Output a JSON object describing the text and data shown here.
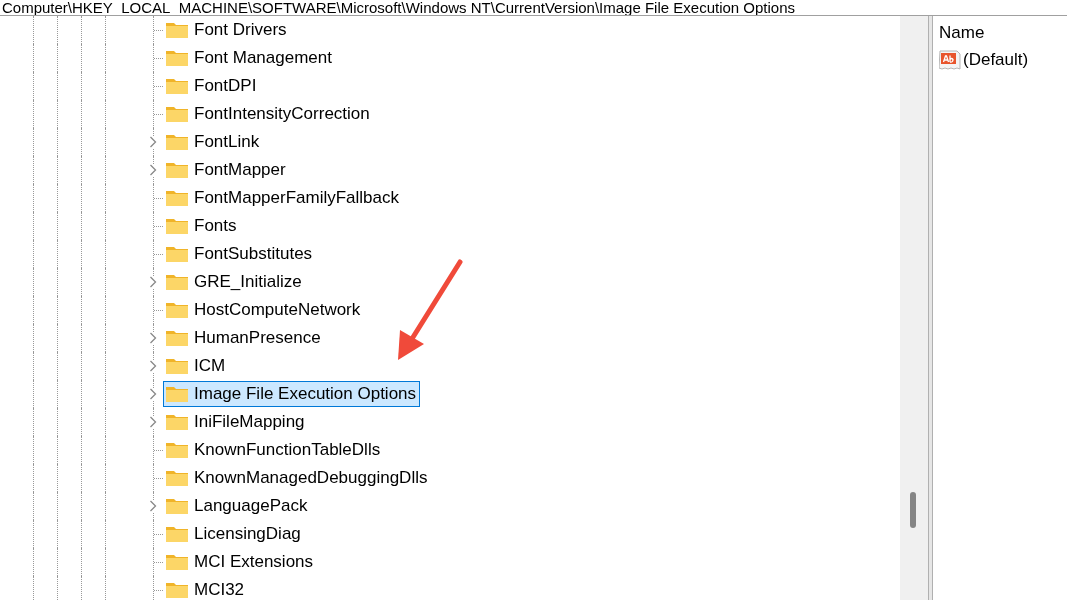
{
  "address_bar": {
    "path": "Computer\\HKEY_LOCAL_MACHINE\\SOFTWARE\\Microsoft\\Windows NT\\CurrentVersion\\Image File Execution Options"
  },
  "tree": {
    "items": [
      {
        "label": "Font Drivers",
        "expandable": false,
        "selected": false
      },
      {
        "label": "Font Management",
        "expandable": false,
        "selected": false
      },
      {
        "label": "FontDPI",
        "expandable": false,
        "selected": false
      },
      {
        "label": "FontIntensityCorrection",
        "expandable": false,
        "selected": false
      },
      {
        "label": "FontLink",
        "expandable": true,
        "selected": false
      },
      {
        "label": "FontMapper",
        "expandable": true,
        "selected": false
      },
      {
        "label": "FontMapperFamilyFallback",
        "expandable": false,
        "selected": false
      },
      {
        "label": "Fonts",
        "expandable": false,
        "selected": false
      },
      {
        "label": "FontSubstitutes",
        "expandable": false,
        "selected": false
      },
      {
        "label": "GRE_Initialize",
        "expandable": true,
        "selected": false
      },
      {
        "label": "HostComputeNetwork",
        "expandable": false,
        "selected": false
      },
      {
        "label": "HumanPresence",
        "expandable": true,
        "selected": false
      },
      {
        "label": "ICM",
        "expandable": true,
        "selected": false
      },
      {
        "label": "Image File Execution Options",
        "expandable": true,
        "selected": true
      },
      {
        "label": "IniFileMapping",
        "expandable": true,
        "selected": false
      },
      {
        "label": "KnownFunctionTableDlls",
        "expandable": false,
        "selected": false
      },
      {
        "label": "KnownManagedDebuggingDlls",
        "expandable": false,
        "selected": false
      },
      {
        "label": "LanguagePack",
        "expandable": true,
        "selected": false
      },
      {
        "label": "LicensingDiag",
        "expandable": false,
        "selected": false
      },
      {
        "label": "MCI Extensions",
        "expandable": false,
        "selected": false
      },
      {
        "label": "MCI32",
        "expandable": false,
        "selected": false
      }
    ]
  },
  "values_pane": {
    "columns": [
      "Name"
    ],
    "rows": [
      {
        "name": "(Default)"
      }
    ]
  }
}
